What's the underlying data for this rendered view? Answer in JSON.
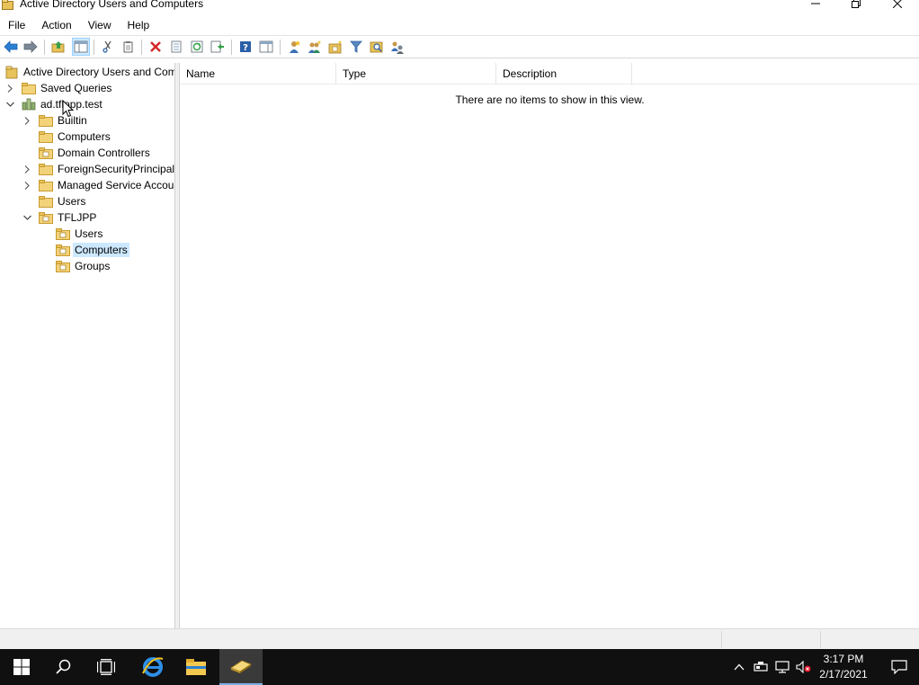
{
  "window": {
    "title": "Active Directory Users and Computers"
  },
  "menu": {
    "items": [
      "File",
      "Action",
      "View",
      "Help"
    ]
  },
  "toolbar": {
    "icons": [
      "back-icon",
      "forward-icon",
      "up-folder-icon",
      "show-hide-tree-icon",
      "cut-icon",
      "copy-icon",
      "delete-icon",
      "properties-icon",
      "refresh-icon",
      "export-list-icon",
      "help-icon",
      "show-action-pane-icon",
      "new-user-icon",
      "new-group-icon",
      "new-ou-icon",
      "filter-icon",
      "find-icon",
      "add-to-group-icon"
    ]
  },
  "tree": {
    "root": "Active Directory Users and Com",
    "items": [
      {
        "label": "Saved Queries",
        "level": 1,
        "expander": "collapsed",
        "icon": "folder-icon"
      },
      {
        "label": "ad.tflopp.test",
        "level": 1,
        "expander": "expanded",
        "icon": "domain-icon"
      },
      {
        "label": "Builtin",
        "level": 2,
        "expander": "collapsed",
        "icon": "folder-icon"
      },
      {
        "label": "Computers",
        "level": 2,
        "expander": "none",
        "icon": "folder-icon"
      },
      {
        "label": "Domain Controllers",
        "level": 2,
        "expander": "none",
        "icon": "ou-icon"
      },
      {
        "label": "ForeignSecurityPrincipals",
        "level": 2,
        "expander": "collapsed",
        "icon": "folder-icon"
      },
      {
        "label": "Managed Service Accour",
        "level": 2,
        "expander": "collapsed",
        "icon": "folder-icon"
      },
      {
        "label": "Users",
        "level": 2,
        "expander": "none",
        "icon": "folder-icon"
      },
      {
        "label": "TFLJPP",
        "level": 2,
        "expander": "expanded",
        "icon": "ou-icon"
      },
      {
        "label": "Users",
        "level": 3,
        "expander": "none",
        "icon": "ou-icon"
      },
      {
        "label": "Computers",
        "level": 3,
        "expander": "none",
        "icon": "ou-icon",
        "selected": true
      },
      {
        "label": "Groups",
        "level": 3,
        "expander": "none",
        "icon": "ou-icon"
      }
    ]
  },
  "list": {
    "columns": [
      "Name",
      "Type",
      "Description"
    ],
    "empty_message": "There are no items to show in this view."
  },
  "taskbar": {
    "time": "3:17 PM",
    "date": "2/17/2021"
  },
  "colors": {
    "selection": "#cce8ff",
    "taskbar": "#101010",
    "folder": "#e8c25a"
  }
}
